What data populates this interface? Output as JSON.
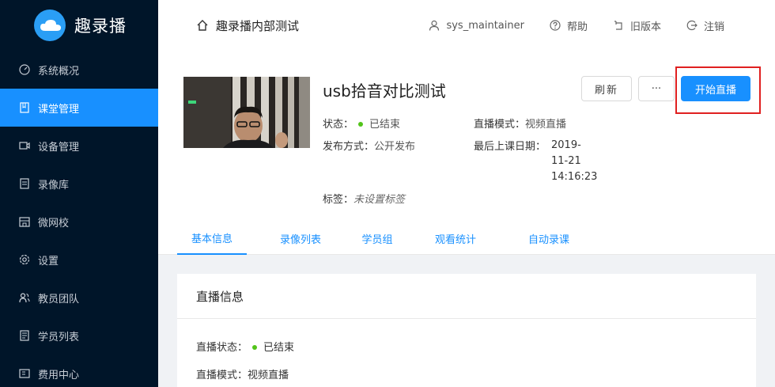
{
  "brand": {
    "name": "趣录播"
  },
  "sidebar": {
    "items": [
      {
        "label": "系统概况",
        "icon": "dashboard-icon"
      },
      {
        "label": "课堂管理",
        "icon": "book-icon",
        "active": true
      },
      {
        "label": "设备管理",
        "icon": "video-device-icon"
      },
      {
        "label": "录像库",
        "icon": "file-icon"
      },
      {
        "label": "微网校",
        "icon": "school-icon"
      },
      {
        "label": "设置",
        "icon": "gear-icon"
      },
      {
        "label": "教员团队",
        "icon": "team-icon"
      },
      {
        "label": "学员列表",
        "icon": "list-icon"
      },
      {
        "label": "费用中心",
        "icon": "billing-icon"
      }
    ]
  },
  "header": {
    "breadcrumb": "趣录播内部测试",
    "user": "sys_maintainer",
    "help": "帮助",
    "old_version": "旧版本",
    "logout": "注销"
  },
  "detail": {
    "title": "usb拾音对比测试",
    "refresh_label": "刷新",
    "more_label": "···",
    "start_label": "开始直播",
    "status_label": "状态：",
    "status_value": "已结束",
    "publish_label": "发布方式：",
    "publish_value": "公开发布",
    "mode_label": "直播模式：",
    "mode_value": "视频直播",
    "last_date_label": "最后上课日期：",
    "last_date_line1": "2019-",
    "last_date_line2": "11-21",
    "last_date_line3": "14:16:23",
    "tags_label": "标签：",
    "tags_value": "未设置标签"
  },
  "tabs": [
    "基本信息",
    "录像列表",
    "学员组",
    "观看统计",
    "自动录课"
  ],
  "panel": {
    "title": "直播信息",
    "status_label": "直播状态：",
    "status_value": "已结束",
    "mode_label": "直播模式：",
    "mode_value": "视频直播"
  },
  "colors": {
    "sidebar_bg": "#001529",
    "accent": "#1890ff",
    "status_green": "#52c41a",
    "highlight_red": "#e02020"
  }
}
